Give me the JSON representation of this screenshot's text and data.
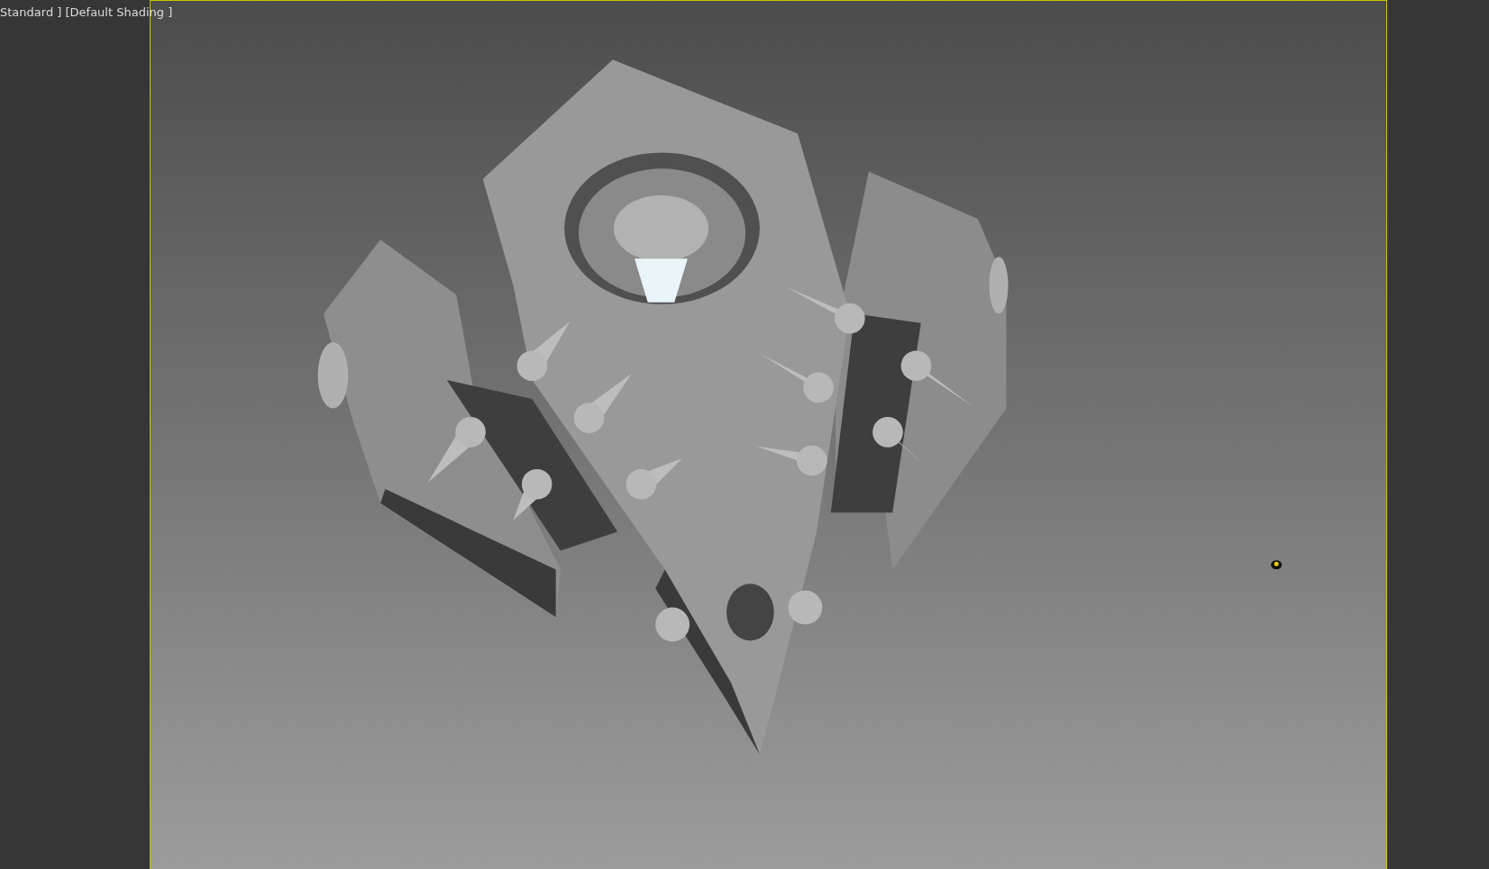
{
  "viewport": {
    "label": "Standard ] [Default Shading ]"
  }
}
